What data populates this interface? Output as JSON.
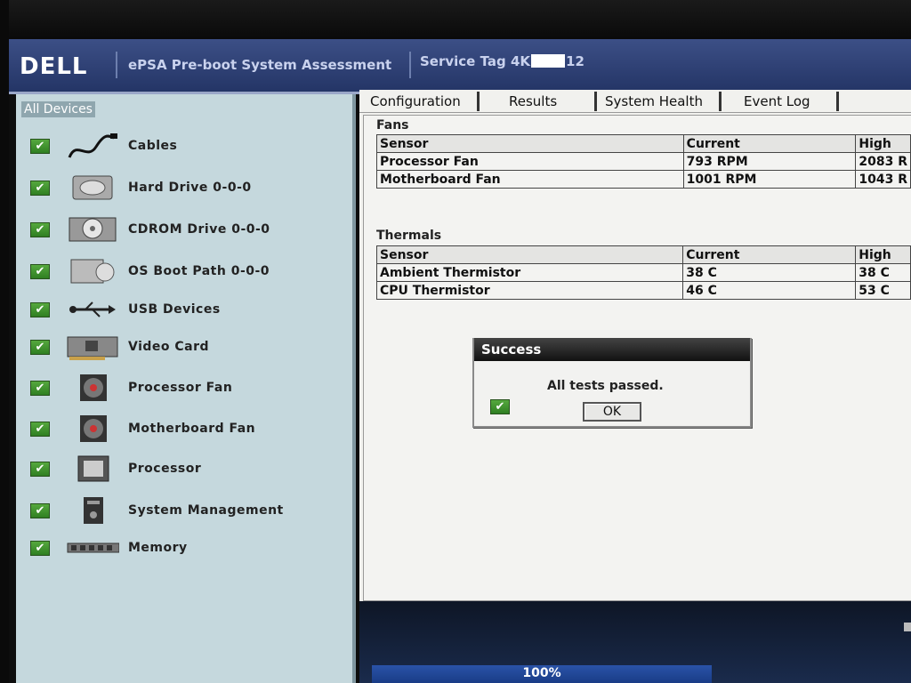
{
  "header": {
    "logo": "DELL",
    "title": "ePSA Pre-boot System Assessment",
    "service_tag_prefix": "Service Tag 4K",
    "service_tag_suffix": "12"
  },
  "sidebar": {
    "title": "All Devices",
    "devices": [
      {
        "label": "Cables",
        "icon": "cable-icon"
      },
      {
        "label": "Hard Drive 0-0-0",
        "icon": "hard-drive-icon"
      },
      {
        "label": "CDROM Drive 0-0-0",
        "icon": "cdrom-icon"
      },
      {
        "label": "OS Boot Path 0-0-0",
        "icon": "boot-path-icon"
      },
      {
        "label": "USB Devices",
        "icon": "usb-icon"
      },
      {
        "label": "Video Card",
        "icon": "video-card-icon"
      },
      {
        "label": "Processor Fan",
        "icon": "fan-icon"
      },
      {
        "label": "Motherboard Fan",
        "icon": "fan-icon"
      },
      {
        "label": "Processor",
        "icon": "processor-icon"
      },
      {
        "label": "System Management",
        "icon": "system-management-icon"
      },
      {
        "label": "Memory",
        "icon": "memory-icon"
      }
    ]
  },
  "tabs": [
    "Configuration",
    "Results",
    "System Health",
    "Event Log"
  ],
  "fans": {
    "title": "Fans",
    "headers": [
      "Sensor",
      "Current",
      "High"
    ],
    "rows": [
      [
        "Processor Fan",
        "793 RPM",
        "2083 R"
      ],
      [
        "Motherboard Fan",
        "1001 RPM",
        "1043 R"
      ]
    ]
  },
  "thermals": {
    "title": "Thermals",
    "headers": [
      "Sensor",
      "Current",
      "High"
    ],
    "rows": [
      [
        "Ambient Thermistor",
        "38 C",
        "38 C"
      ],
      [
        "CPU Thermistor",
        "46 C",
        "53 C"
      ]
    ]
  },
  "dialog": {
    "title": "Success",
    "message": "All tests passed.",
    "ok_label": "OK"
  },
  "progress": {
    "label": "100%",
    "value": 1.0
  },
  "colors": {
    "header": "#2f4178",
    "sidebar": "#c5d8dd",
    "check": "#3f9530"
  }
}
